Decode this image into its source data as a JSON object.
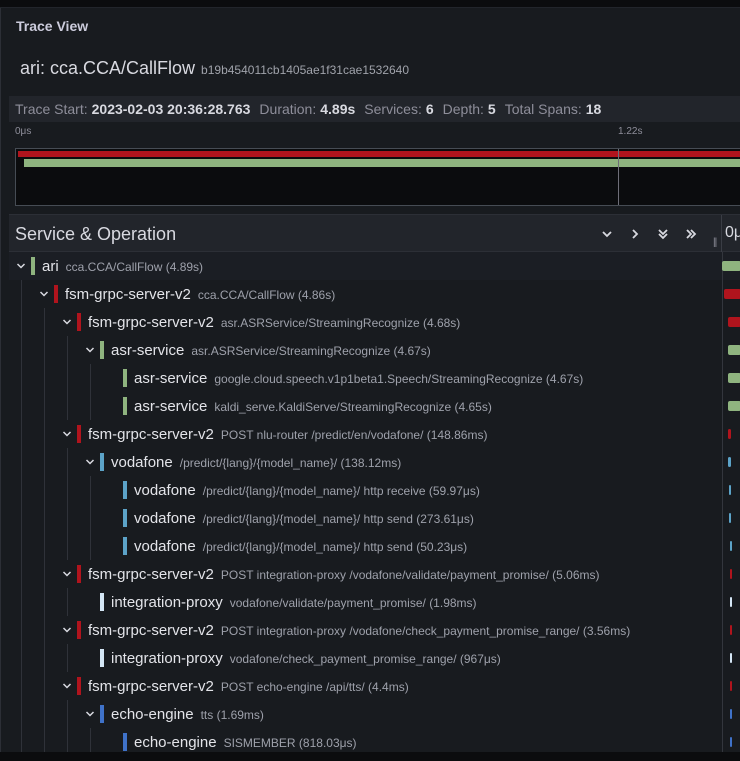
{
  "panel": {
    "title": "Trace View"
  },
  "trace": {
    "name": "ari: cca.CCA/CallFlow",
    "id": "b19b454011cb1405ae1f31cae1532640"
  },
  "stats": {
    "start_label": "Trace Start:",
    "start_value": "2023-02-03 20:36:28.763",
    "duration_label": "Duration:",
    "duration_value": "4.89s",
    "services_label": "Services:",
    "services_value": "6",
    "depth_label": "Depth:",
    "depth_value": "5",
    "spans_label": "Total Spans:",
    "spans_value": "18"
  },
  "minimap": {
    "tick_start": "0μs",
    "tick_mid": "1.22s"
  },
  "section": {
    "title": "Service & Operation",
    "timeline_start": "0μs"
  },
  "colors": {
    "ari": "#8fb47f",
    "fsm": "#b0141d",
    "asr": "#8fb47f",
    "vodafone": "#5ca3c8",
    "integration": "#d4e6f5",
    "echo": "#3f72c9"
  },
  "spans": [
    {
      "service": "ari",
      "operation": "cca.CCA/CallFlow (4.89s)",
      "depth": 0,
      "expanded": true,
      "color_key": "ari"
    },
    {
      "service": "fsm-grpc-server-v2",
      "operation": "cca.CCA/CallFlow (4.86s)",
      "depth": 1,
      "expanded": true,
      "color_key": "fsm"
    },
    {
      "service": "fsm-grpc-server-v2",
      "operation": "asr.ASRService/StreamingRecognize (4.68s)",
      "depth": 2,
      "expanded": true,
      "color_key": "fsm"
    },
    {
      "service": "asr-service",
      "operation": "asr.ASRService/StreamingRecognize (4.67s)",
      "depth": 3,
      "expanded": true,
      "color_key": "asr"
    },
    {
      "service": "asr-service",
      "operation": "google.cloud.speech.v1p1beta1.Speech/StreamingRecognize (4.67s)",
      "depth": 4,
      "expanded": null,
      "color_key": "asr"
    },
    {
      "service": "asr-service",
      "operation": "kaldi_serve.KaldiServe/StreamingRecognize (4.65s)",
      "depth": 4,
      "expanded": null,
      "color_key": "asr"
    },
    {
      "service": "fsm-grpc-server-v2",
      "operation": "POST nlu-router /predict/en/vodafone/ (148.86ms)",
      "depth": 2,
      "expanded": true,
      "color_key": "fsm"
    },
    {
      "service": "vodafone",
      "operation": "/predict/{lang}/{model_name}/ (138.12ms)",
      "depth": 3,
      "expanded": true,
      "color_key": "vodafone"
    },
    {
      "service": "vodafone",
      "operation": "/predict/{lang}/{model_name}/ http receive (59.97μs)",
      "depth": 4,
      "expanded": null,
      "color_key": "vodafone"
    },
    {
      "service": "vodafone",
      "operation": "/predict/{lang}/{model_name}/ http send (273.61μs)",
      "depth": 4,
      "expanded": null,
      "color_key": "vodafone"
    },
    {
      "service": "vodafone",
      "operation": "/predict/{lang}/{model_name}/ http send (50.23μs)",
      "depth": 4,
      "expanded": null,
      "color_key": "vodafone"
    },
    {
      "service": "fsm-grpc-server-v2",
      "operation": "POST integration-proxy /vodafone/validate/payment_promise/ (5.06ms)",
      "depth": 2,
      "expanded": true,
      "color_key": "fsm"
    },
    {
      "service": "integration-proxy",
      "operation": "vodafone/validate/payment_promise/ (1.98ms)",
      "depth": 3,
      "expanded": null,
      "color_key": "integration"
    },
    {
      "service": "fsm-grpc-server-v2",
      "operation": "POST integration-proxy /vodafone/check_payment_promise_range/ (3.56ms)",
      "depth": 2,
      "expanded": true,
      "color_key": "fsm"
    },
    {
      "service": "integration-proxy",
      "operation": "vodafone/check_payment_promise_range/ (967μs)",
      "depth": 3,
      "expanded": null,
      "color_key": "integration"
    },
    {
      "service": "fsm-grpc-server-v2",
      "operation": "POST echo-engine /api/tts/ (4.4ms)",
      "depth": 2,
      "expanded": true,
      "color_key": "fsm"
    },
    {
      "service": "echo-engine",
      "operation": "tts (1.69ms)",
      "depth": 3,
      "expanded": true,
      "color_key": "echo"
    },
    {
      "service": "echo-engine",
      "operation": "SISMEMBER (818.03μs)",
      "depth": 4,
      "expanded": null,
      "color_key": "echo"
    }
  ]
}
